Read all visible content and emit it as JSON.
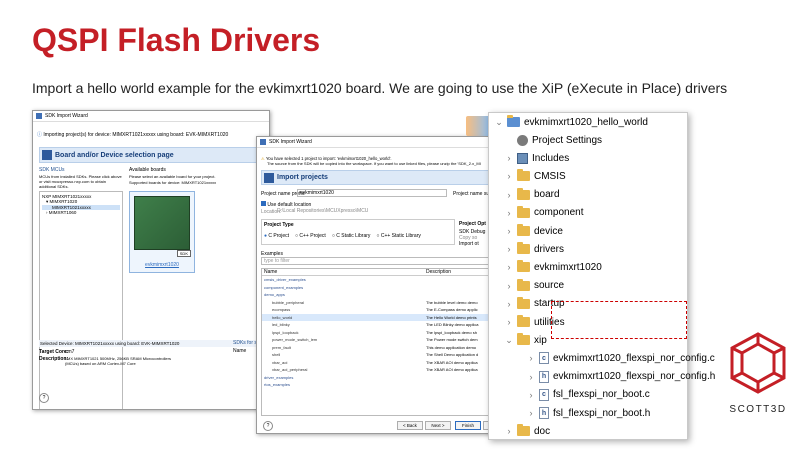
{
  "slide": {
    "title": "QSPI Flash Drivers",
    "subtitle": "Import a hello world example for the evkimxrt1020 board. We are going to use the XiP (eXecute in Place) drivers"
  },
  "win1": {
    "title": "SDK Import Wizard",
    "info": "Importing project(s) for device: MIMXRT1021xxxxx using board: EVK-MIMXRT1020",
    "heading": "Board and/or Device selection page",
    "sdk_tab": "SDK MCUs",
    "boards_tab": "Available boards",
    "boards_hint": "Please select an available board for your project.",
    "boards_supported": "Supported boards for device: MIMXRT1021xxxxx",
    "sdk_hint": "MCUs from installed SDKs. Please click above or visit mcuxpresso.nxp.com to obtain additional SDKs.",
    "tree_items": [
      "NXP MIMXRT1021xxxxx",
      "MIMXRT1020",
      "MIMXRT1021xxxxx",
      "MIMXRT1060"
    ],
    "board_name": "evkmimxrt1020",
    "selected_text": "Selected Device: MIMXRT1021xxxxx using board: EVK-MIMXRT1020",
    "target_core_label": "Target Core:",
    "target_core": "cm7",
    "description_label": "Description:",
    "description": "i.MX MIMXRT1021 500MHz, 256KB SRAM Microcontrollers (MCUs) based on ARM Cortex-M7 Core",
    "sdk_for_sel": "SDKs for sel",
    "name_col": "Name",
    "help": "?"
  },
  "win2": {
    "title": "SDK Import Wizard",
    "notice": "You have selected 1 project to import: 'evkmimxrt1020_hello_world'.",
    "notice2": "The source from the SDK will be copied into the workspace. If you want to use linked files, please unzip the 'SDK_2.x_MI",
    "heading": "Import projects",
    "prefix_label": "Project name prefix:",
    "prefix_value": "evkmimxrt1020",
    "suffix_label": "Project name suff",
    "use_default": "Use default location",
    "location_label": "Location:",
    "location_value": "D:\\Local Repositories\\MCUXpresso\\MCU",
    "ptype_label": "Project Type",
    "ptype_opts": [
      "C Project",
      "C++ Project",
      "C Static Library",
      "C++ Static Library"
    ],
    "popts_label": "Project Opt",
    "sdk_debug": "SDK Debug",
    "copy_sources": "Copy so",
    "import_other": "Import ot",
    "examples_label": "Examples",
    "filter_placeholder": "type to filter",
    "col_name": "Name",
    "col_desc": "Description",
    "examples": [
      [
        "cmsis_driver_examples",
        ""
      ],
      [
        "component_examples",
        ""
      ],
      [
        "demo_apps",
        ""
      ],
      [
        "bubble_peripheral",
        "The bubble level demo demo"
      ],
      [
        "ecompass",
        "The E-Compass demo applic"
      ],
      [
        "hello_world",
        "The Hello World demo prints"
      ],
      [
        "led_blinky",
        "The LED Blinky demo applica"
      ],
      [
        "lpspi_loopback",
        "The lpspi_loopback demo sh"
      ],
      [
        "power_mode_switch_lem",
        "The Power mode switch dem"
      ],
      [
        "prem_fault",
        "This demo application demo"
      ],
      [
        "shell",
        "The Shell Demo application d"
      ],
      [
        "xbar_aoi",
        "The XBAR AOI demo applica"
      ],
      [
        "xbar_aoi_peripheral",
        "The XBAR AOI demo applica"
      ],
      [
        "driver_examples",
        ""
      ],
      [
        "rtos_examples",
        ""
      ]
    ],
    "btn_back": "< Back",
    "btn_next": "Next >",
    "btn_finish": "Finish",
    "btn_cancel": "Cancel",
    "help": "?"
  },
  "tree": {
    "root": "evkmimxrt1020_hello_world",
    "items": [
      "Project Settings",
      "Includes",
      "CMSIS",
      "board",
      "component",
      "device",
      "drivers",
      "evkmimxrt1020",
      "source",
      "startup",
      "utilities",
      "xip",
      "evkmimxrt1020_flexspi_nor_config.c",
      "evkmimxrt1020_flexspi_nor_config.h",
      "fsl_flexspi_nor_boot.c",
      "fsl_flexspi_nor_boot.h",
      "doc"
    ]
  },
  "logo": {
    "text": "SCOTT3D"
  },
  "colors": {
    "title": "#c41f26",
    "highlight": "#cc0000"
  }
}
